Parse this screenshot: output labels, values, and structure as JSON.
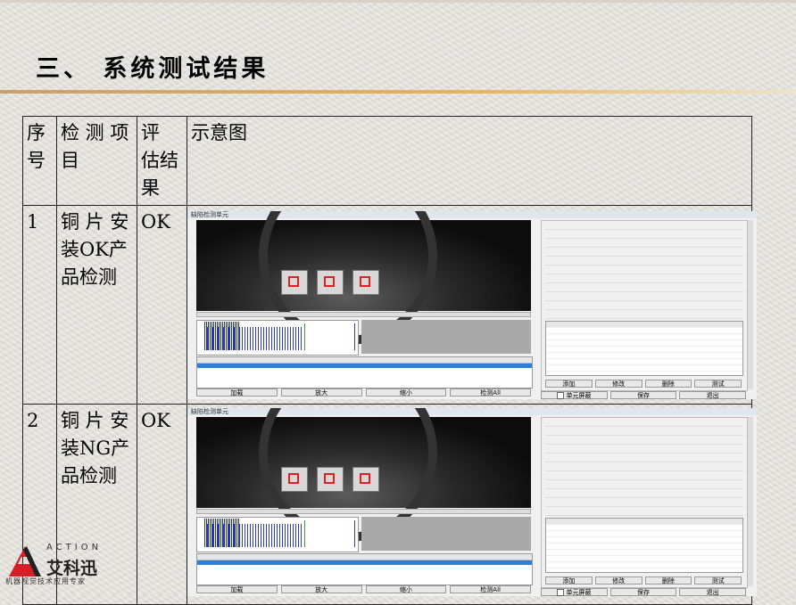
{
  "heading": "三、 系统测试结果",
  "table": {
    "headers": {
      "index": "序号",
      "item": "检 测 项目",
      "result": "评 估结果",
      "diagram": "示意图"
    },
    "rows": [
      {
        "index": "1",
        "item": "铜 片 安装OK产品检测",
        "result": "OK",
        "window_title": "缺陷检测单元"
      },
      {
        "index": "2",
        "item": "铜 片 安装NG产品检测",
        "result": "OK",
        "window_title": "缺陷检测单元"
      }
    ]
  },
  "screenshot_ui": {
    "buttons": [
      "加载",
      "放大",
      "缩小",
      "检测All"
    ],
    "footer": [
      "单元屏蔽",
      "保存",
      "退出"
    ],
    "right_buttons": [
      "添加",
      "修改",
      "删除",
      "测试"
    ]
  },
  "logo": {
    "brand_en": "ACTION",
    "brand_cn": "艾科迅",
    "slogan": "机器视觉技术应用专家"
  }
}
